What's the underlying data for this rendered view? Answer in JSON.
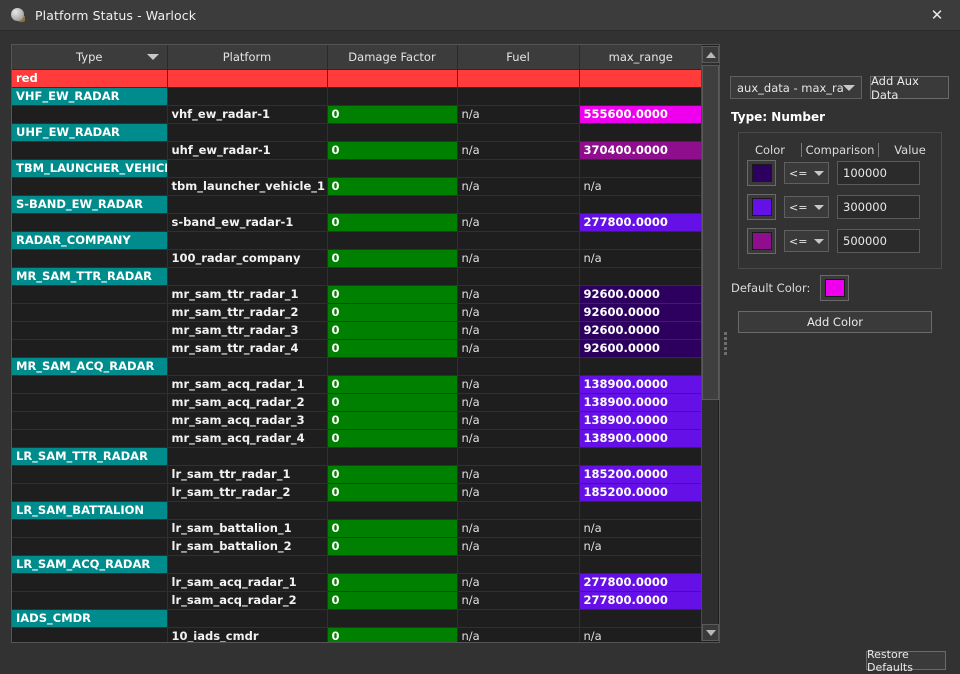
{
  "window": {
    "title": "Platform Status - Warlock",
    "icon": "radar-dish-icon",
    "close_label": "✕"
  },
  "table": {
    "columns": [
      {
        "label": "Type",
        "sorted": true,
        "sort_icon": "sort-desc-icon"
      },
      {
        "label": "Platform"
      },
      {
        "label": "Damage Factor"
      },
      {
        "label": "Fuel"
      },
      {
        "label": "max_range"
      }
    ],
    "rows": [
      {
        "kind": "force",
        "type": "red",
        "platform": "",
        "damage": "",
        "fuel": "",
        "max_range": ""
      },
      {
        "kind": "group",
        "type": "VHF_EW_RADAR"
      },
      {
        "kind": "item",
        "platform": "vhf_ew_radar-1",
        "damage": "0",
        "fuel": "n/a",
        "max_range": "555600.0000",
        "max_range_color": "#ee00ee"
      },
      {
        "kind": "group",
        "type": "UHF_EW_RADAR"
      },
      {
        "kind": "item",
        "platform": "uhf_ew_radar-1",
        "damage": "0",
        "fuel": "n/a",
        "max_range": "370400.0000",
        "max_range_color": "#8e0e8e"
      },
      {
        "kind": "group",
        "type": "TBM_LAUNCHER_VEHICLE"
      },
      {
        "kind": "item",
        "platform": "tbm_launcher_vehicle_1",
        "damage": "0",
        "fuel": "n/a",
        "max_range": "n/a"
      },
      {
        "kind": "group",
        "type": "S-BAND_EW_RADAR"
      },
      {
        "kind": "item",
        "platform": "s-band_ew_radar-1",
        "damage": "0",
        "fuel": "n/a",
        "max_range": "277800.0000",
        "max_range_color": "#6610e8"
      },
      {
        "kind": "group",
        "type": "RADAR_COMPANY"
      },
      {
        "kind": "item",
        "platform": "100_radar_company",
        "damage": "0",
        "fuel": "n/a",
        "max_range": "n/a"
      },
      {
        "kind": "group",
        "type": "MR_SAM_TTR_RADAR"
      },
      {
        "kind": "item",
        "platform": "mr_sam_ttr_radar_1",
        "damage": "0",
        "fuel": "n/a",
        "max_range": "92600.0000",
        "max_range_color": "#2d0060"
      },
      {
        "kind": "item",
        "platform": "mr_sam_ttr_radar_2",
        "damage": "0",
        "fuel": "n/a",
        "max_range": "92600.0000",
        "max_range_color": "#2d0060"
      },
      {
        "kind": "item",
        "platform": "mr_sam_ttr_radar_3",
        "damage": "0",
        "fuel": "n/a",
        "max_range": "92600.0000",
        "max_range_color": "#2d0060"
      },
      {
        "kind": "item",
        "platform": "mr_sam_ttr_radar_4",
        "damage": "0",
        "fuel": "n/a",
        "max_range": "92600.0000",
        "max_range_color": "#2d0060"
      },
      {
        "kind": "group",
        "type": "MR_SAM_ACQ_RADAR"
      },
      {
        "kind": "item",
        "platform": "mr_sam_acq_radar_1",
        "damage": "0",
        "fuel": "n/a",
        "max_range": "138900.0000",
        "max_range_color": "#6610e8"
      },
      {
        "kind": "item",
        "platform": "mr_sam_acq_radar_2",
        "damage": "0",
        "fuel": "n/a",
        "max_range": "138900.0000",
        "max_range_color": "#6610e8"
      },
      {
        "kind": "item",
        "platform": "mr_sam_acq_radar_3",
        "damage": "0",
        "fuel": "n/a",
        "max_range": "138900.0000",
        "max_range_color": "#6610e8"
      },
      {
        "kind": "item",
        "platform": "mr_sam_acq_radar_4",
        "damage": "0",
        "fuel": "n/a",
        "max_range": "138900.0000",
        "max_range_color": "#6610e8"
      },
      {
        "kind": "group",
        "type": "LR_SAM_TTR_RADAR"
      },
      {
        "kind": "item",
        "platform": "lr_sam_ttr_radar_1",
        "damage": "0",
        "fuel": "n/a",
        "max_range": "185200.0000",
        "max_range_color": "#6610e8"
      },
      {
        "kind": "item",
        "platform": "lr_sam_ttr_radar_2",
        "damage": "0",
        "fuel": "n/a",
        "max_range": "185200.0000",
        "max_range_color": "#6610e8"
      },
      {
        "kind": "group",
        "type": "LR_SAM_BATTALION"
      },
      {
        "kind": "item",
        "platform": "lr_sam_battalion_1",
        "damage": "0",
        "fuel": "n/a",
        "max_range": "n/a"
      },
      {
        "kind": "item",
        "platform": "lr_sam_battalion_2",
        "damage": "0",
        "fuel": "n/a",
        "max_range": "n/a"
      },
      {
        "kind": "group",
        "type": "LR_SAM_ACQ_RADAR"
      },
      {
        "kind": "item",
        "platform": "lr_sam_acq_radar_1",
        "damage": "0",
        "fuel": "n/a",
        "max_range": "277800.0000",
        "max_range_color": "#6610e8"
      },
      {
        "kind": "item",
        "platform": "lr_sam_acq_radar_2",
        "damage": "0",
        "fuel": "n/a",
        "max_range": "277800.0000",
        "max_range_color": "#6610e8"
      },
      {
        "kind": "group",
        "type": "IADS_CMDR"
      },
      {
        "kind": "item",
        "platform": "10_iads_cmdr",
        "damage": "0",
        "fuel": "n/a",
        "max_range": "n/a"
      }
    ],
    "colors": {
      "force_row": "#ff3b3b",
      "group_header": "#008c8c",
      "damage_cell": "#008000"
    }
  },
  "scrollbar": {
    "up_icon": "scroll-up-arrow-icon",
    "down_icon": "scroll-down-arrow-icon",
    "thumb": "scroll-thumb"
  },
  "splitter": {
    "grip_icon": "splitter-grip-icon"
  },
  "right_panel": {
    "aux_combo": {
      "value": "aux_data - max_range",
      "arrow_icon": "chevron-down-icon"
    },
    "add_aux_label": "Add Aux Data",
    "type_label": "Type: Number",
    "rules_header": {
      "color": "Color",
      "comparison": "Comparison",
      "value": "Value"
    },
    "rules": [
      {
        "color": "#2d0060",
        "comparison": "<=",
        "value": "100000"
      },
      {
        "color": "#6610e8",
        "comparison": "<=",
        "value": "300000"
      },
      {
        "color": "#8e0e8e",
        "comparison": "<=",
        "value": "500000"
      }
    ],
    "default_color_label": "Default Color:",
    "default_color": "#ee00ee",
    "add_color_label": "Add Color",
    "restore_defaults_label": "Restore Defaults"
  }
}
